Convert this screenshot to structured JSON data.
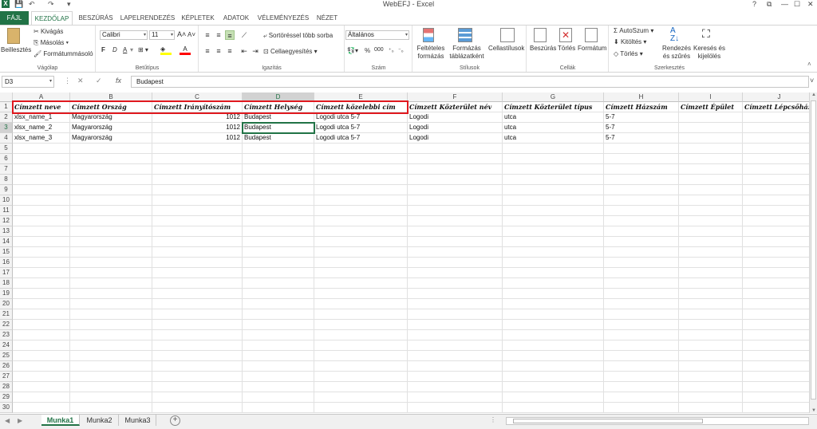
{
  "titlebar": {
    "title": "WebEFJ - Excel",
    "logo": "X",
    "help": "?",
    "restore": "⧉",
    "minimize": "—",
    "maximize": "☐",
    "close": "✕"
  },
  "tabs": [
    "FÁJL",
    "KEZDŐLAP",
    "BESZÚRÁS",
    "LAPELRENDEZÉS",
    "KÉPLETEK",
    "ADATOK",
    "VÉLEMÉNYEZÉS",
    "NÉZET"
  ],
  "ribbon": {
    "clipboard": {
      "paste": "Beillesztés",
      "cut": "Kivágás",
      "copy": "Másolás",
      "format_painter": "Formátummásoló",
      "label": "Vágólap"
    },
    "font": {
      "name": "Calibri",
      "size": "11",
      "grow": "A",
      "shrink": "A",
      "bold": "F",
      "italic": "D",
      "underline": "A",
      "fill_color": "#ffff00",
      "font_color": "#ff0000",
      "label": "Betűtípus"
    },
    "alignment": {
      "wrap": "Sortöréssel több sorba",
      "merge": "Cellaegyesítés",
      "label": "Igazítás"
    },
    "number": {
      "format": "Általános",
      "percent": "%",
      "thousands": "000",
      "label": "Szám"
    },
    "styles": {
      "conditional": "Feltételes formázás",
      "table": "Formázás táblázatként",
      "cell_styles": "Cellastílusok",
      "label": "Stílusok"
    },
    "cells": {
      "insert": "Beszúrás",
      "delete": "Törlés",
      "format": "Formátum",
      "label": "Cellák"
    },
    "editing": {
      "autosum": "AutoSzum",
      "fill": "Kitöltés",
      "clear": "Törlés",
      "sort": "Rendezés és szűrés",
      "find": "Keresés és kijelölés",
      "label": "Szerkesztés"
    }
  },
  "formula_bar": {
    "name_box": "D3",
    "cancel": "✕",
    "enter": "✓",
    "fx": "fx",
    "content": "Budapest"
  },
  "columns": [
    "A",
    "B",
    "C",
    "D",
    "E",
    "F",
    "G",
    "H",
    "I",
    "J"
  ],
  "selected_column": "D",
  "selected_row": "3",
  "rows": [
    "1",
    "2",
    "3",
    "4",
    "5",
    "6",
    "7",
    "8",
    "9",
    "10",
    "11",
    "12",
    "13",
    "14",
    "15",
    "16",
    "17",
    "18",
    "19",
    "20",
    "21",
    "22",
    "23",
    "24",
    "25",
    "26",
    "27",
    "28",
    "29",
    "30"
  ],
  "header_row": [
    "Címzett neve",
    "Címzett Ország",
    "Címzett Irányítószám",
    "Címzett Helység",
    "Címzett közelebbi cím",
    "Címzett Közterület név",
    "Címzett Közterület típus",
    "Címzett Házszám",
    "Címzett Épület",
    "Címzett Lépcsőház"
  ],
  "data_rows": [
    [
      "xlsx_name_1",
      "Magyarország",
      "1012",
      "Budapest",
      "Logodi utca 5-7",
      "Logodi",
      "utca",
      "5-7",
      "",
      ""
    ],
    [
      "xlsx_name_2",
      "Magyarország",
      "1012",
      "Budapest",
      "Logodi utca 5-7",
      "Logodi",
      "utca",
      "5-7",
      "",
      ""
    ],
    [
      "xlsx_name_3",
      "Magyarország",
      "1012",
      "Budapest",
      "Logodi utca 5-7",
      "Logodi",
      "utca",
      "5-7",
      "",
      ""
    ]
  ],
  "sheets": [
    "Munka1",
    "Munka2",
    "Munka3"
  ],
  "active_sheet": "Munka1",
  "accent_color": "#217346",
  "highlight_color": "#e0191f"
}
